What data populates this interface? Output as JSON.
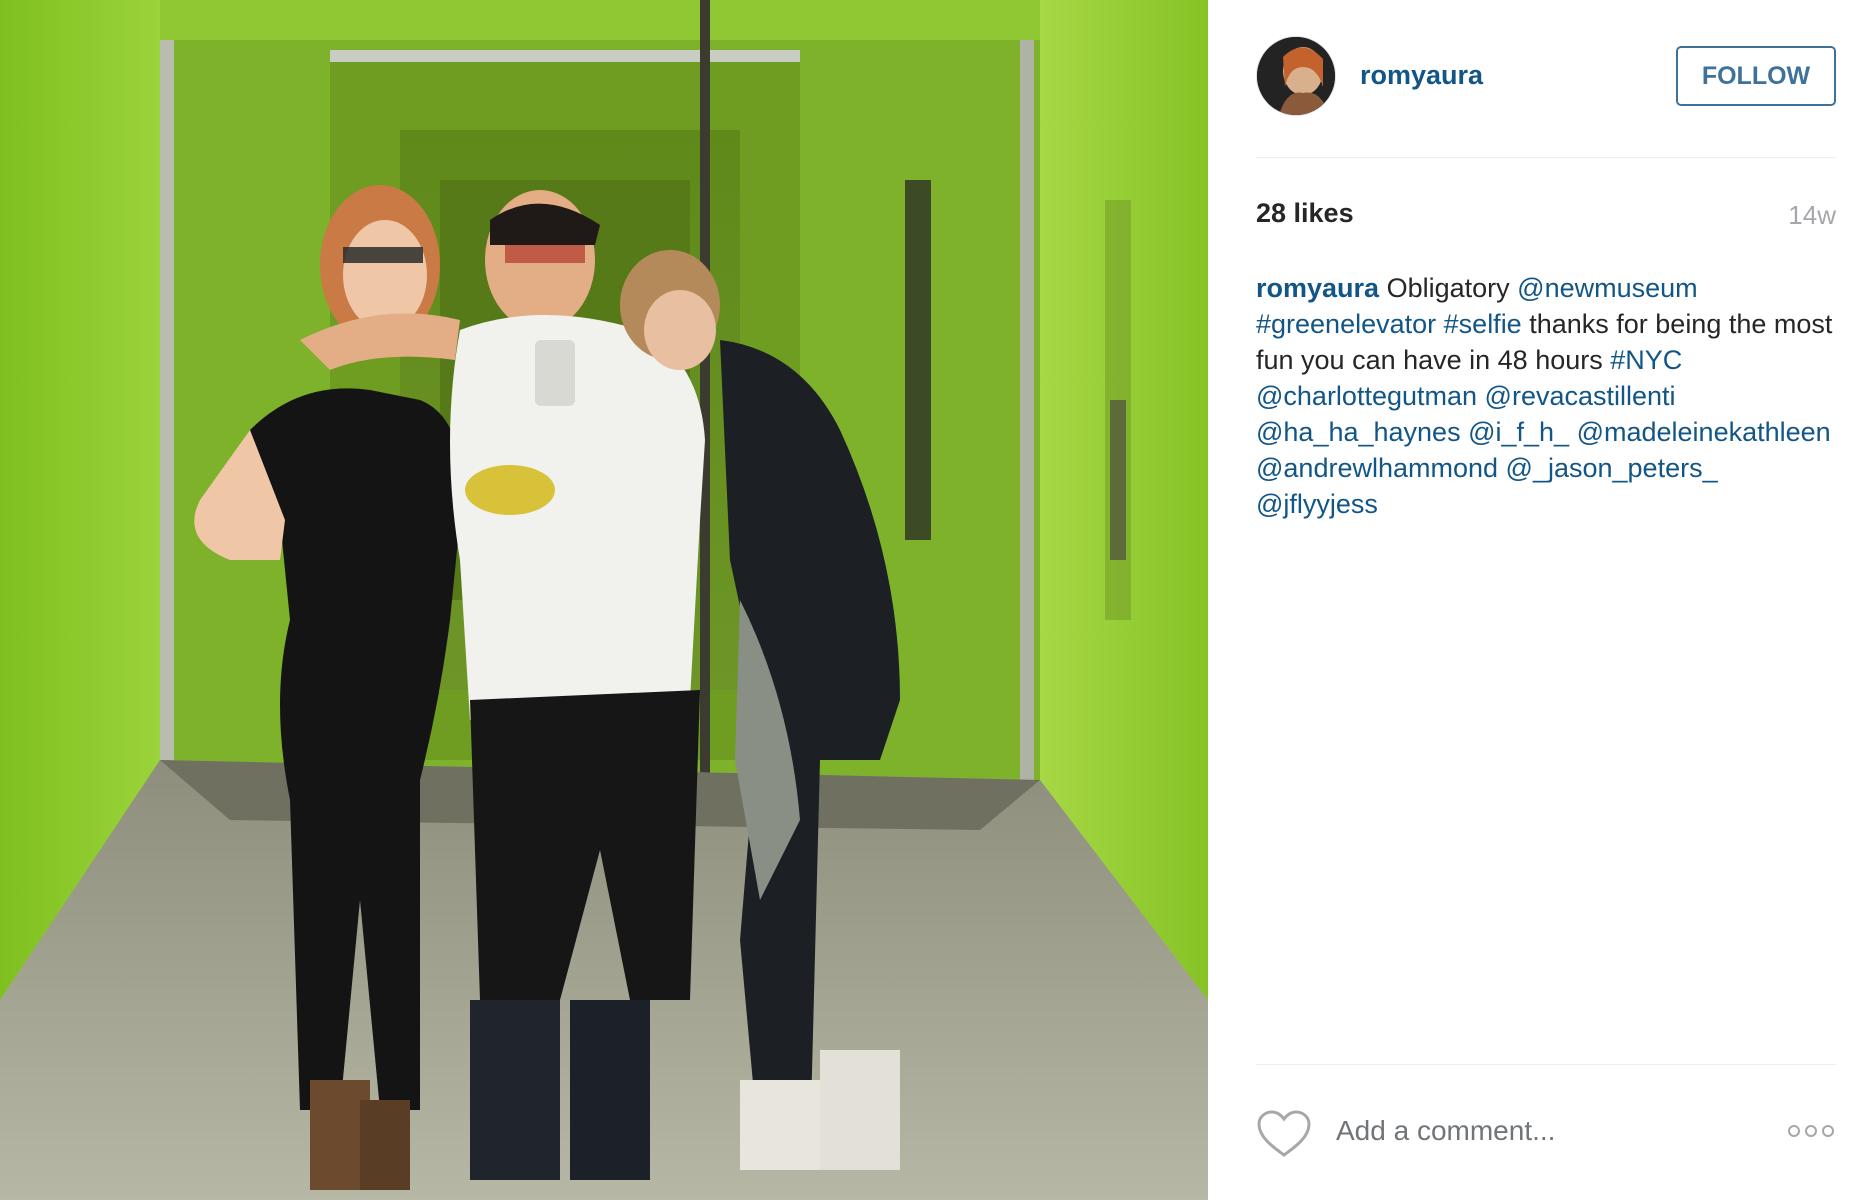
{
  "photo": {
    "alt_icon": "elevator-mirror-selfie-photo"
  },
  "post": {
    "username": "romyaura",
    "follow_label": "FOLLOW",
    "likes": "28 likes",
    "time_ago": "14w",
    "caption": {
      "author": "romyaura",
      "t1": "Obligatory",
      "m1": "@newmuseum",
      "h1": "#greenelevator",
      "h2": "#selfie",
      "t2": "thanks for being the most fun you can have in 48 hours",
      "h3": "#NYC",
      "m2": "@charlottegutman",
      "m3": "@revacastillenti",
      "m4": "@ha_ha_haynes",
      "m5": "@i_f_h_",
      "m6": "@madeleinekathleen",
      "m7": "@andrewlhammond",
      "m8": "@_jason_peters_",
      "m9": "@jflyyjess"
    },
    "comment_placeholder": "Add a comment..."
  },
  "icons": {
    "like": "heart-outline-icon",
    "more": "ellipsis-icon"
  },
  "colors": {
    "link": "#125688",
    "follow": "#3f729b",
    "muted": "#a5a7aa",
    "text": "#262626",
    "elevator_green": "#8fc832"
  }
}
